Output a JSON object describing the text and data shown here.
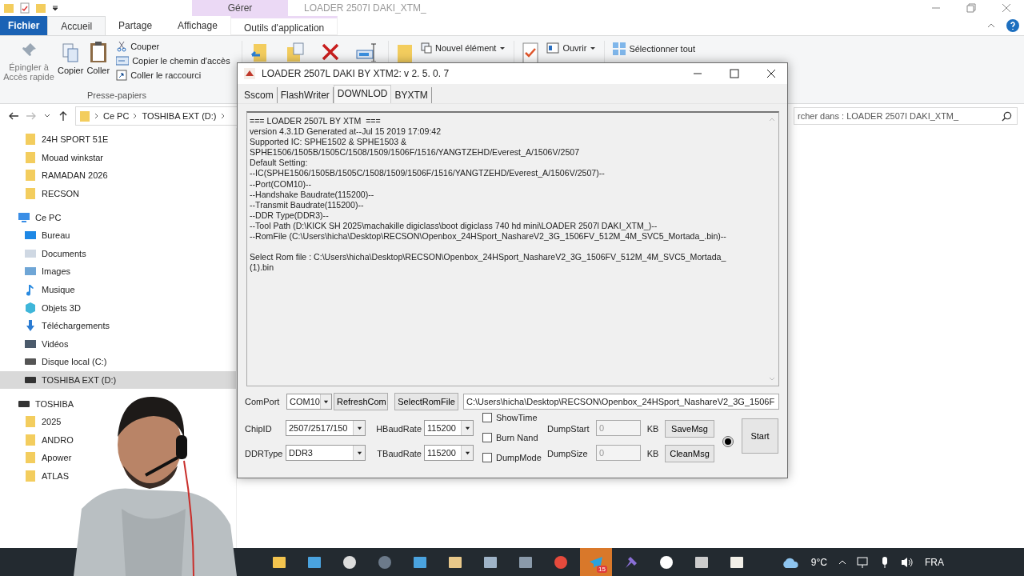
{
  "explorer": {
    "context_tab": "Gérer",
    "title": "LOADER 2507I DAKI_XTM_",
    "ribbon_tabs": [
      {
        "label": "Fichier",
        "kind": "file",
        "selected": false
      },
      {
        "label": "Accueil",
        "kind": "tab",
        "selected": true
      },
      {
        "label": "Partage",
        "kind": "tab",
        "selected": false
      },
      {
        "label": "Affichage",
        "kind": "tab",
        "selected": false
      },
      {
        "label": "Outils d'application",
        "kind": "context",
        "selected": false
      }
    ],
    "clipboard": {
      "large": [
        {
          "label": "Épingler à Accès rapide",
          "disabled": true
        },
        {
          "label": "Copier",
          "disabled": false
        },
        {
          "label": "Coller",
          "disabled": false
        }
      ],
      "small": [
        "Couper",
        "Copier le chemin d'accès",
        "Coller le raccourci"
      ],
      "label": "Presse-papiers"
    },
    "new_item": "Nouvel élément",
    "open": "Ouvrir",
    "select_all": "Sélectionner tout",
    "path": [
      "Ce PC",
      "TOSHIBA EXT (D:)"
    ],
    "search": {
      "placeholder": "rcher dans : LOADER 2507I DAKI_XTM_"
    },
    "sidebar": [
      {
        "label": "24H SPORT 51E",
        "kind": "folder",
        "selected": false
      },
      {
        "label": "Mouad winkstar",
        "kind": "folder",
        "selected": false
      },
      {
        "label": "RAMADAN 2026",
        "kind": "folder",
        "selected": false
      },
      {
        "label": "RECSON",
        "kind": "folder",
        "selected": false
      },
      {
        "label": "Ce PC",
        "kind": "pc",
        "selected": false,
        "children": [
          {
            "label": "Bureau",
            "kind": "desktop",
            "selected": false
          },
          {
            "label": "Documents",
            "kind": "documents",
            "selected": false
          },
          {
            "label": "Images",
            "kind": "images",
            "selected": false
          },
          {
            "label": "Musique",
            "kind": "music",
            "selected": false
          },
          {
            "label": "Objets 3D",
            "kind": "objects3d",
            "selected": false
          },
          {
            "label": "Téléchargements",
            "kind": "downloads",
            "selected": false
          },
          {
            "label": "Vidéos",
            "kind": "videos",
            "selected": false
          },
          {
            "label": "Disque local (C:)",
            "kind": "localdisk",
            "selected": false
          },
          {
            "label": "TOSHIBA EXT (D:)",
            "kind": "drive",
            "selected": true
          }
        ]
      },
      {
        "label": "TOSHIBA",
        "kind": "drive",
        "selected": false,
        "children": [
          {
            "label": "2025",
            "kind": "folder",
            "selected": false
          },
          {
            "label": "ANDRO",
            "kind": "folder",
            "selected": false
          },
          {
            "label": "Apower",
            "kind": "folder",
            "selected": false
          },
          {
            "label": "ATLAS",
            "kind": "folder",
            "selected": false
          }
        ]
      }
    ]
  },
  "dialog": {
    "title": "LOADER 2507L DAKI BY XTM2: v  2. 5. 0. 7",
    "tabs": [
      {
        "label": "Sscom",
        "selected": false
      },
      {
        "label": "FlashWriter",
        "selected": false
      },
      {
        "label": "DOWNLOD",
        "selected": true
      },
      {
        "label": "BYXTM",
        "selected": false
      }
    ],
    "log": [
      {
        "lines": [
          "=== LOADER 2507L BY XTM  ===",
          "version 4.3.1D Generated at--Jul 15 2019 17:09:42",
          "Supported IC: SPHE1502 & SPHE1503 &",
          "SPHE1506/1505B/1505C/1508/1509/1506F/1516/YANGTZEHD/Everest_A/1506V/2507",
          "Default Setting:",
          "--IC(SPHE1506/1505B/1505C/1508/1509/1506F/1516/YANGTZEHD/Everest_A/1506V/2507)--",
          "--Port(COM10)--",
          "--Handshake Baudrate(115200)--",
          "--Transmit Baudrate(115200)--",
          "--DDR Type(DDR3)--",
          "--Tool Path (D:\\KICK SH 2025\\machakille digiclass\\boot digiclass 740 hd mini\\LOADER 2507l DAKI_XTM_)--",
          "--RomFile (C:\\Users\\hicha\\Desktop\\RECSON\\Openbox_24HSport_NashareV2_3G_1506FV_512M_4M_SVC5_Mortada_.bin)--"
        ]
      },
      {
        "lines": [
          "Select Rom file : C:\\Users\\hicha\\Desktop\\RECSON\\Openbox_24HSport_NashareV2_3G_1506FV_512M_4M_SVC5_Mortada_",
          "(1).bin"
        ]
      }
    ],
    "comport": {
      "label": "ComPort",
      "value": "COM10"
    },
    "refresh": "RefreshCom",
    "select_rom": "SelectRomFile",
    "rom_path": "C:\\Users\\hicha\\Desktop\\RECSON\\Openbox_24HSport_NashareV2_3G_1506F",
    "chip_id": {
      "label": "ChipID",
      "value": "2507/2517/150"
    },
    "ddr_type": {
      "label": "DDRType",
      "value": "DDR3"
    },
    "h_baud": {
      "label": "HBaudRate",
      "value": "115200"
    },
    "t_baud": {
      "label": "TBaudRate",
      "value": "115200"
    },
    "options": [
      {
        "label": "ShowTime",
        "checked": false
      },
      {
        "label": "Burn Nand",
        "checked": false
      },
      {
        "label": "DumpMode",
        "checked": false
      }
    ],
    "dump_start": {
      "label": "DumpStart",
      "value": "0",
      "unit": "KB",
      "disabled": true
    },
    "dump_size": {
      "label": "DumpSize",
      "value": "0",
      "unit": "KB",
      "disabled": true
    },
    "save_msg": "SaveMsg",
    "clean_msg": "CleanMsg",
    "indicator_on": true,
    "start": "Start"
  },
  "taskbar": {
    "apps": [
      {
        "kind": "folder",
        "active": false
      },
      {
        "kind": "monitor",
        "active": false
      },
      {
        "kind": "record",
        "active": false
      },
      {
        "kind": "camera",
        "active": false
      },
      {
        "kind": "window",
        "active": false
      },
      {
        "kind": "palette",
        "active": false
      },
      {
        "kind": "calculator",
        "active": false
      },
      {
        "kind": "lock",
        "active": false
      },
      {
        "kind": "browser",
        "active": false
      },
      {
        "kind": "telegram",
        "active": true,
        "badge": "15"
      },
      {
        "kind": "satellite",
        "active": false
      },
      {
        "kind": "gear",
        "active": false
      },
      {
        "kind": "printer",
        "active": false
      },
      {
        "kind": "logo",
        "active": false
      }
    ],
    "temperature": "9°C",
    "language": "FRA"
  }
}
